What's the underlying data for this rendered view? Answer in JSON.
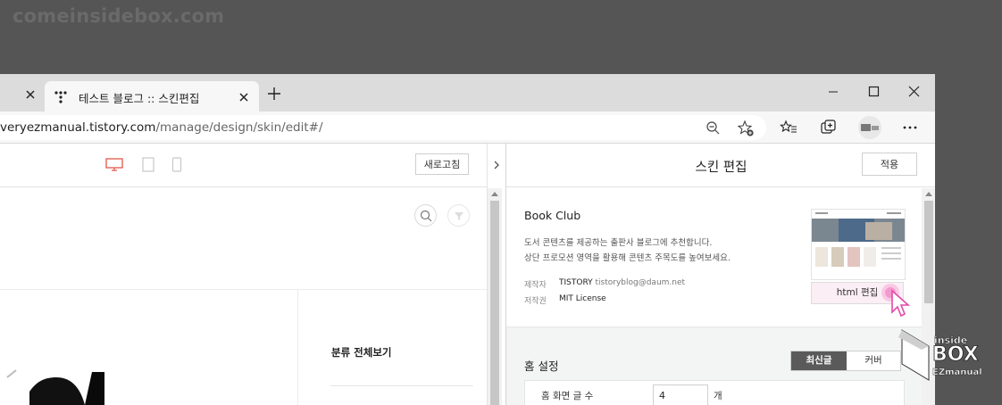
{
  "watermark": "comeinsidebox.com",
  "browser": {
    "tab_title": "테스트 블로그 :: 스킨편집",
    "url_prefix": "veryezmanual.tistory.com",
    "url_path": "/manage/design/skin/edit#/"
  },
  "preview": {
    "refresh_label": "새로고침",
    "category_title": "분류 전체보기"
  },
  "panel": {
    "title": "스킨 편집",
    "apply_label": "적용",
    "skin_name": "Book Club",
    "desc_line1": "도서 콘텐츠를 제공하는 출판사 블로그에 추천합니다.",
    "desc_line2": "상단 프로모션 영역을 활용해 콘텐츠 주목도를 높여보세요.",
    "maker_label": "제작자",
    "maker_value": "TISTORY",
    "maker_email": "tistoryblog@daum.net",
    "license_label": "저작권",
    "license_value": "MIT License",
    "html_edit_label": "html 편집",
    "home_title": "홈 설정",
    "seg_latest": "최신글",
    "seg_cover": "커버",
    "home_count_label": "홈 화면 글 수",
    "home_count_value": "4",
    "home_count_unit": "개"
  },
  "brand": {
    "line1": "inside",
    "line2": "BOX",
    "line3": "EZmanual"
  }
}
